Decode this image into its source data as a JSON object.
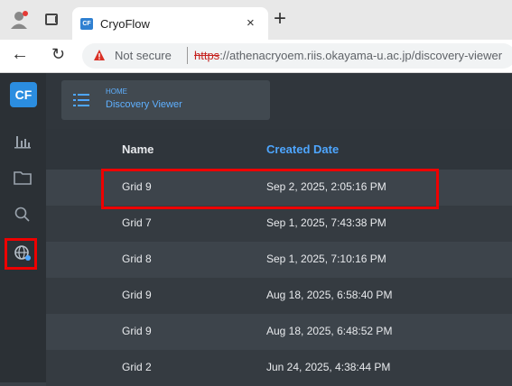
{
  "browser": {
    "tab_title": "CryoFlow",
    "tab_close": "×",
    "new_tab": "+",
    "security_label": "Not secure",
    "url_scheme": "https",
    "url_rest": "://athenacryoem.riis.okayama-u.ac.jp/discovery-viewer",
    "favicon_text": "CF"
  },
  "app": {
    "logo_text": "CF",
    "rail_icons": [
      "bar-chart-icon",
      "folder-icon",
      "search-icon",
      "globe-icon"
    ],
    "active_rail_icon": "globe-icon",
    "breadcrumb": {
      "home": "HOME",
      "page": "Discovery Viewer"
    },
    "accent_color": "#4ea6ff",
    "highlight_color": "#e00000"
  },
  "table": {
    "columns": {
      "name": "Name",
      "created": "Created Date"
    },
    "rows": [
      {
        "name": "Grid 9",
        "created": "Sep 2, 2025, 2:05:16 PM"
      },
      {
        "name": "Grid 7",
        "created": "Sep 1, 2025, 7:43:38 PM"
      },
      {
        "name": "Grid 8",
        "created": "Sep 1, 2025, 7:10:16 PM"
      },
      {
        "name": "Grid 9",
        "created": "Aug 18, 2025, 6:58:40 PM"
      },
      {
        "name": "Grid 9",
        "created": "Aug 18, 2025, 6:48:52 PM"
      },
      {
        "name": "Grid 2",
        "created": "Jun 24, 2025, 4:38:44 PM"
      }
    ]
  }
}
